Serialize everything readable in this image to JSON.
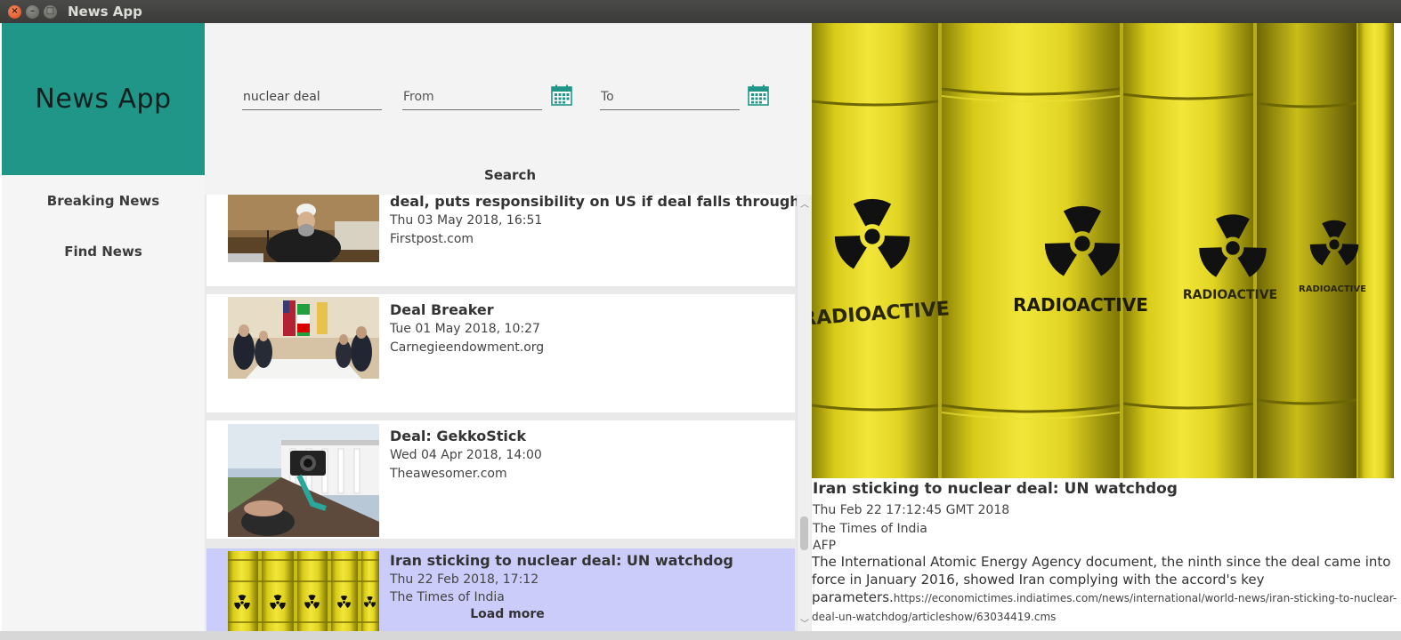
{
  "window": {
    "title": "News App",
    "controls": [
      "close-icon",
      "minimize-icon",
      "maximize-icon"
    ]
  },
  "sidebar": {
    "brand": "News App",
    "items": [
      {
        "label": "Breaking News"
      },
      {
        "label": "Find News"
      }
    ]
  },
  "search": {
    "query_value": "nuclear deal",
    "from_placeholder": "From",
    "to_placeholder": "To",
    "button_label": "Search",
    "calendar_icon": "calendar-icon"
  },
  "results": [
    {
      "title": "deal, puts responsibility on US if deal falls through",
      "date": "Thu 03 May 2018, 16:51",
      "source": "Firstpost.com"
    },
    {
      "title": "Deal Breaker",
      "date": "Tue 01 May 2018, 10:27",
      "source": "Carnegieendowment.org"
    },
    {
      "title": "Deal: GekkoStick",
      "date": "Wed 04 Apr 2018, 14:00",
      "source": "Theawesomer.com"
    },
    {
      "title": "Iran sticking to nuclear deal: UN watchdog",
      "date": "Thu 22 Feb 2018, 17:12",
      "source": "The Times of India",
      "selected": true
    }
  ],
  "load_more_label": "Load more",
  "detail": {
    "title": "Iran sticking to nuclear deal: UN watchdog",
    "published": "Thu Feb 22 17:12:45 GMT 2018",
    "source": "The Times of India",
    "author": "AFP",
    "description": "The International Atomic Energy Agency document, the ninth since the deal came into force in January 2016, showed Iran complying with the accord's key parameters.",
    "url": "https://economictimes.indiatimes.com/news/international/world-news/iran-sticking-to-nuclear-deal-un-watchdog/articleshow/63034419.cms",
    "image_label": "RADIOACTIVE"
  },
  "colors": {
    "brand": "#1f9688",
    "selected_row": "#ccccfb",
    "calendar": "#1f9688",
    "barrel": "#e8dc2a"
  }
}
